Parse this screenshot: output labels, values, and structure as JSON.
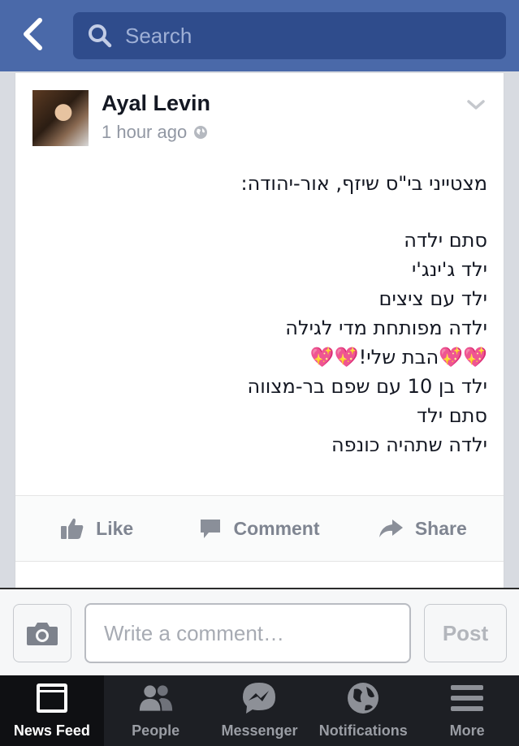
{
  "search": {
    "placeholder": "Search"
  },
  "story": {
    "author": "Ayal Levin",
    "timestamp": "1 hour ago",
    "lines": [
      "מצטייני בי\"ס שיזף, אור-יהודה:",
      "סתם ילדה",
      "ילד ג'ינג'י",
      "ילד עם ציצים",
      "ילדה מפותחת מדי לגילה",
      "💖💖הבת שלי!💖💖",
      "ילד בן 10 עם שפם בר-מצווה",
      "סתם ילד",
      "ילדה שתהיה כונפה"
    ],
    "actions": {
      "like": "Like",
      "comment": "Comment",
      "share": "Share"
    }
  },
  "comment_bar": {
    "placeholder": "Write a comment…",
    "post_label": "Post"
  },
  "tabs": [
    {
      "label": "News Feed",
      "icon": "news-feed-icon",
      "active": true
    },
    {
      "label": "People",
      "icon": "people-icon"
    },
    {
      "label": "Messenger",
      "icon": "messenger-icon"
    },
    {
      "label": "Notifications",
      "icon": "globe-icon"
    },
    {
      "label": "More",
      "icon": "menu-icon"
    }
  ],
  "colors": {
    "nav": "#4a69a9",
    "search_bg": "#2f4c8c",
    "tabbar": "#1d1f24",
    "heart": "#e8408c"
  }
}
